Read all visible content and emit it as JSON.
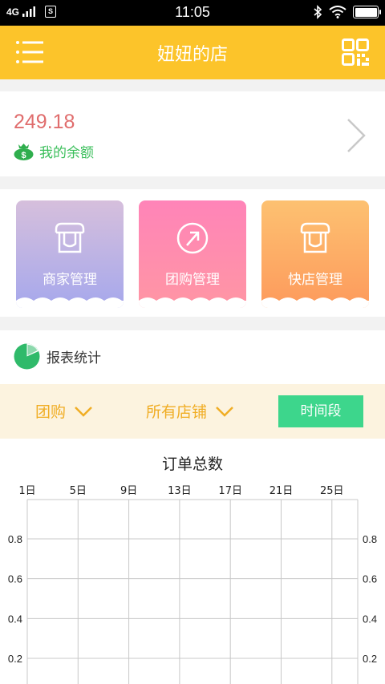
{
  "status_bar": {
    "network": "4G",
    "sim_badge": "S",
    "time": "11:05",
    "battery_level": 1.0
  },
  "header": {
    "title": "妞妞的店",
    "background": "#fcc42a",
    "menu_icon": "menu-icon",
    "qr_icon": "qr-code-icon"
  },
  "balance": {
    "amount": "249.18",
    "label": "我的余额",
    "amount_color": "#e06d6d",
    "label_color": "#3bbf5b",
    "icon": "money-bag-icon"
  },
  "tiles": [
    {
      "label": "商家管理",
      "icon": "storefront-icon"
    },
    {
      "label": "团购管理",
      "icon": "group-buy-icon"
    },
    {
      "label": "快店管理",
      "icon": "storefront-icon"
    }
  ],
  "report": {
    "title": "报表统计",
    "icon": "pie-chart-icon",
    "filters": {
      "type_label": "团购",
      "store_label": "所有店铺",
      "period_button": "时间段"
    }
  },
  "chart_data": {
    "type": "line",
    "title": "订单总数",
    "x_ticks": [
      "1日",
      "5日",
      "9日",
      "13日",
      "17日",
      "21日",
      "25日"
    ],
    "y_ticks": [
      0.8,
      0.6,
      0.4,
      0.2
    ],
    "ylim": [
      0,
      1
    ],
    "grid": true,
    "series": []
  }
}
